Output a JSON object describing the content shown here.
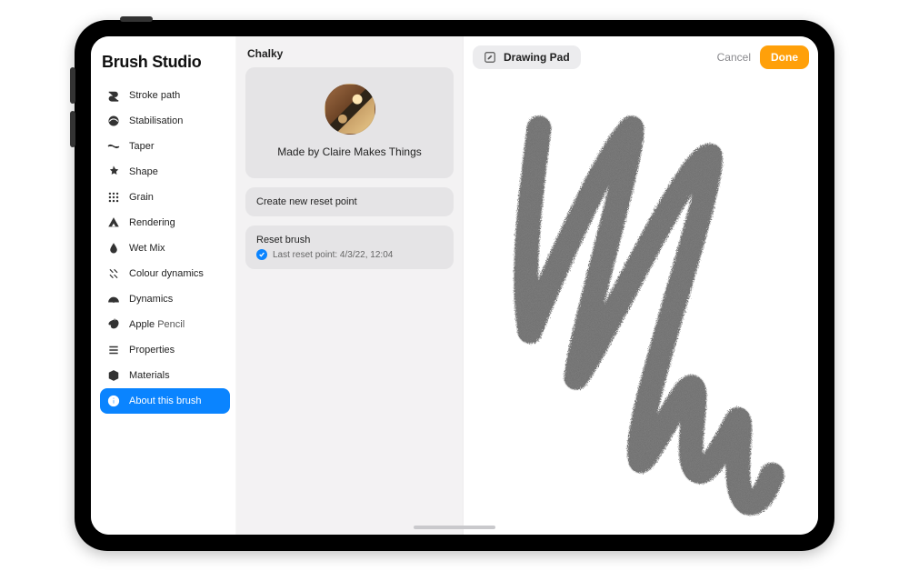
{
  "app_title": "Brush Studio",
  "sidebar": {
    "items": [
      {
        "id": "stroke-path",
        "label": "Stroke path"
      },
      {
        "id": "stabilisation",
        "label": "Stabilisation"
      },
      {
        "id": "taper",
        "label": "Taper"
      },
      {
        "id": "shape",
        "label": "Shape"
      },
      {
        "id": "grain",
        "label": "Grain"
      },
      {
        "id": "rendering",
        "label": "Rendering"
      },
      {
        "id": "wet-mix",
        "label": "Wet Mix"
      },
      {
        "id": "colour-dynamics",
        "label": "Colour dynamics"
      },
      {
        "id": "dynamics",
        "label": "Dynamics"
      },
      {
        "id": "apple-pencil",
        "label_main": "Apple",
        "label_sub": "Pencil"
      },
      {
        "id": "properties",
        "label": "Properties"
      },
      {
        "id": "materials",
        "label": "Materials"
      },
      {
        "id": "about",
        "label": "About this brush",
        "active": true
      }
    ]
  },
  "panel": {
    "brush_name": "Chalky",
    "made_by": "Made by Claire Makes Things",
    "create_reset": "Create new reset point",
    "reset_brush": "Reset brush",
    "reset_subtitle": "Last reset point: 4/3/22, 12:04"
  },
  "toolbar": {
    "drawing_pad": "Drawing Pad",
    "cancel": "Cancel",
    "done": "Done"
  },
  "colors": {
    "accent": "#0a84ff",
    "done": "#ffa00a"
  }
}
